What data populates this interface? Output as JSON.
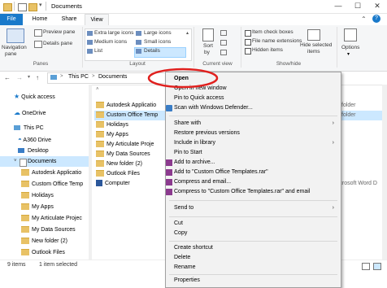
{
  "window": {
    "title": "Documents",
    "minimize": "—",
    "maximize": "☐",
    "close": "✕"
  },
  "ribbon": {
    "tabs": [
      "File",
      "Home",
      "Share",
      "View"
    ],
    "panes": {
      "navigation_pane": "Navigation",
      "navigation_pane_2": "pane",
      "preview_pane": "Preview pane",
      "details_pane": "Details pane",
      "group_label": "Panes"
    },
    "layout": {
      "extra_large_icons": "Extra large icons",
      "large_icons": "Large icons",
      "medium_icons": "Medium icons",
      "small_icons": "Small icons",
      "list": "List",
      "details": "Details",
      "group_label": "Layout"
    },
    "current_view": {
      "sort": "Sort",
      "sort_2": "by",
      "group_label": "Current view"
    },
    "show_hide": {
      "item_check_boxes": "Item check boxes",
      "file_name_extensions": "File name extensions",
      "hidden_items": "Hidden items",
      "hide_selected": "Hide selected",
      "hide_selected_2": "items",
      "group_label": "Show/hide"
    },
    "options": {
      "label": "Options"
    }
  },
  "address": {
    "path": [
      "This PC",
      "Documents"
    ],
    "separator": ">"
  },
  "nav": {
    "quick_access": "Quick access",
    "onedrive": "OneDrive",
    "this_pc": "This PC",
    "a360": "A360 Drive",
    "desktop": "Desktop",
    "documents": "Documents",
    "folders": [
      "Autodesk Applicatio",
      "Custom Office Temp",
      "Holidays",
      "My Apps",
      "My Articulate Projec",
      "My Data Sources",
      "New folder (2)",
      "Outlook Files"
    ]
  },
  "files": {
    "items": [
      "Autodesk Applicatio",
      "Custom Office Temp",
      "Holidays",
      "My Apps",
      "My Articulate Proje",
      "My Data Sources",
      "New folder (2)",
      "Outlook Files",
      "Computer"
    ],
    "type_col": [
      "folder",
      "folder",
      "",
      "",
      "",
      "",
      "",
      "",
      ""
    ],
    "word_doc": "Microsoft Word D"
  },
  "status": {
    "count": "9 items",
    "selected": "1 item selected"
  },
  "context_menu": {
    "open": "Open",
    "open_new_window": "Open in new window",
    "pin_quick": "Pin to Quick access",
    "scan": "Scan with Windows Defender...",
    "share_with": "Share with",
    "restore": "Restore previous versions",
    "include": "Include in library",
    "pin_start": "Pin to Start",
    "add_archive": "Add to archive...",
    "add_rar": "Add to \"Custom Office Templates.rar\"",
    "compress_email": "Compress and email...",
    "compress_rar_email": "Compress to \"Custom Office Templates.rar\" and email",
    "send_to": "Send to",
    "cut": "Cut",
    "copy": "Copy",
    "create_shortcut": "Create shortcut",
    "delete": "Delete",
    "rename": "Rename",
    "properties": "Properties",
    "arrow": "›"
  },
  "colors": {
    "accent": "#1979ca",
    "highlight_ring": "#e0201e",
    "selection": "#cce8ff"
  }
}
